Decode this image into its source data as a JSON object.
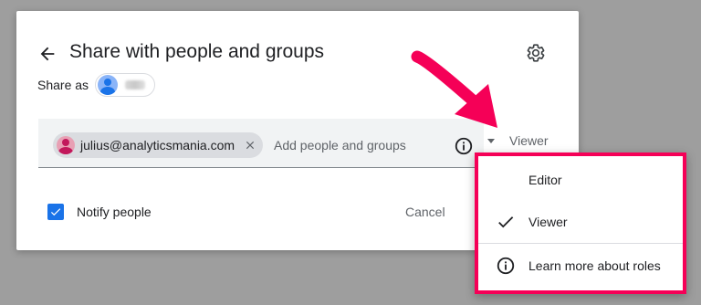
{
  "dialog": {
    "title": "Share with people and groups",
    "share_as_label": "Share as",
    "add_placeholder": "Add people and groups",
    "recipient_email": "julius@analyticsmania.com",
    "role_selected": "Viewer",
    "notify_label": "Notify people",
    "notify_checked": true,
    "cancel_label": "Cancel"
  },
  "role_menu": {
    "items": [
      {
        "label": "Editor",
        "selected": false
      },
      {
        "label": "Viewer",
        "selected": true
      }
    ],
    "learn_more_label": "Learn more about roles"
  },
  "colors": {
    "accent": "#1a73e8",
    "highlight": "#f50057",
    "backdrop": "#9e9e9e"
  },
  "icons": [
    "back-arrow-icon",
    "gear-icon",
    "close-icon",
    "info-icon",
    "dropdown-arrow-icon",
    "checkmark-icon",
    "checkbox-icon"
  ]
}
